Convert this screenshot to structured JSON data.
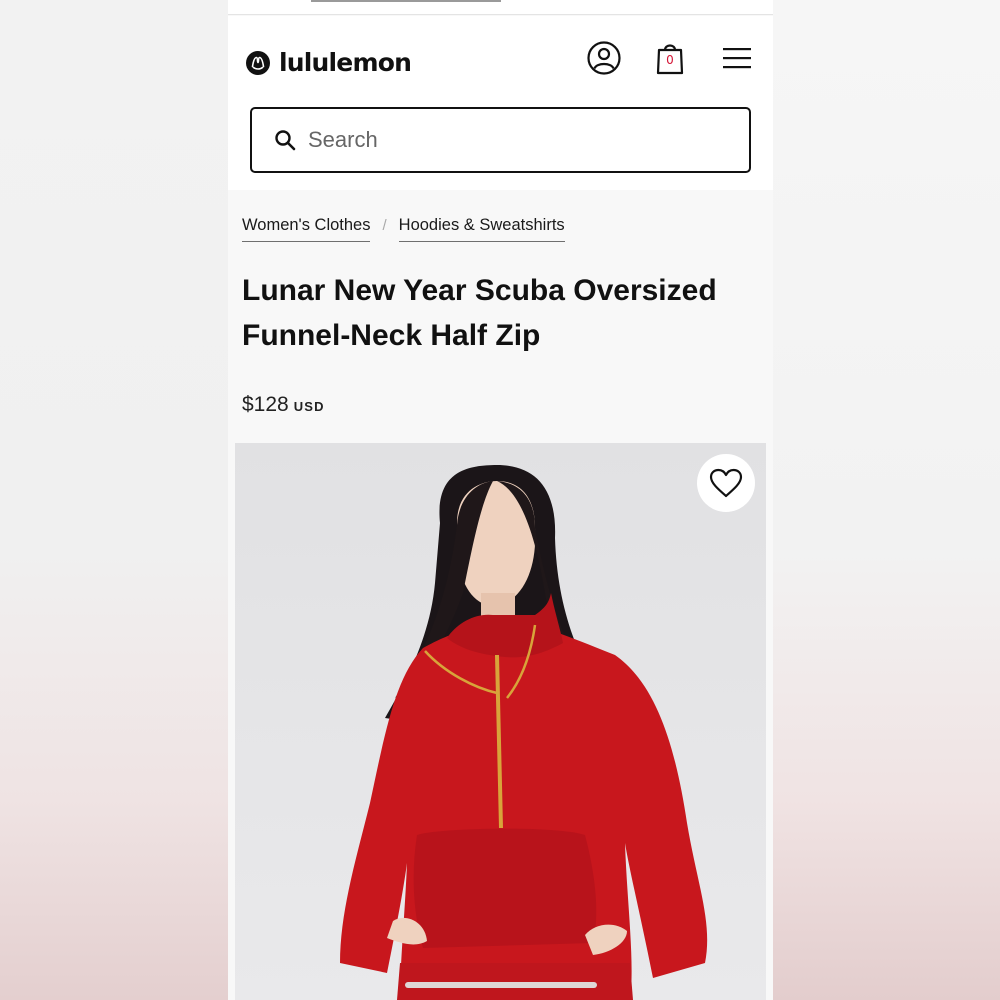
{
  "brand": {
    "name": "lululemon",
    "accent_color": "#d31334"
  },
  "header": {
    "account_icon": "account-icon",
    "bag_icon": "shopping-bag-icon",
    "bag_count": "0",
    "menu_icon": "hamburger-menu-icon"
  },
  "search": {
    "placeholder": "Search",
    "value": ""
  },
  "breadcrumb": {
    "items": [
      {
        "label": "Women's Clothes"
      },
      {
        "label": "Hoodies & Sweatshirts"
      }
    ],
    "separator": "/"
  },
  "product": {
    "title": "Lunar New Year Scuba Oversized Funnel-Neck Half Zip",
    "price": "$128",
    "currency": "USD",
    "garment_color": "#c8171d",
    "wishlist_icon": "heart-outline-icon"
  }
}
